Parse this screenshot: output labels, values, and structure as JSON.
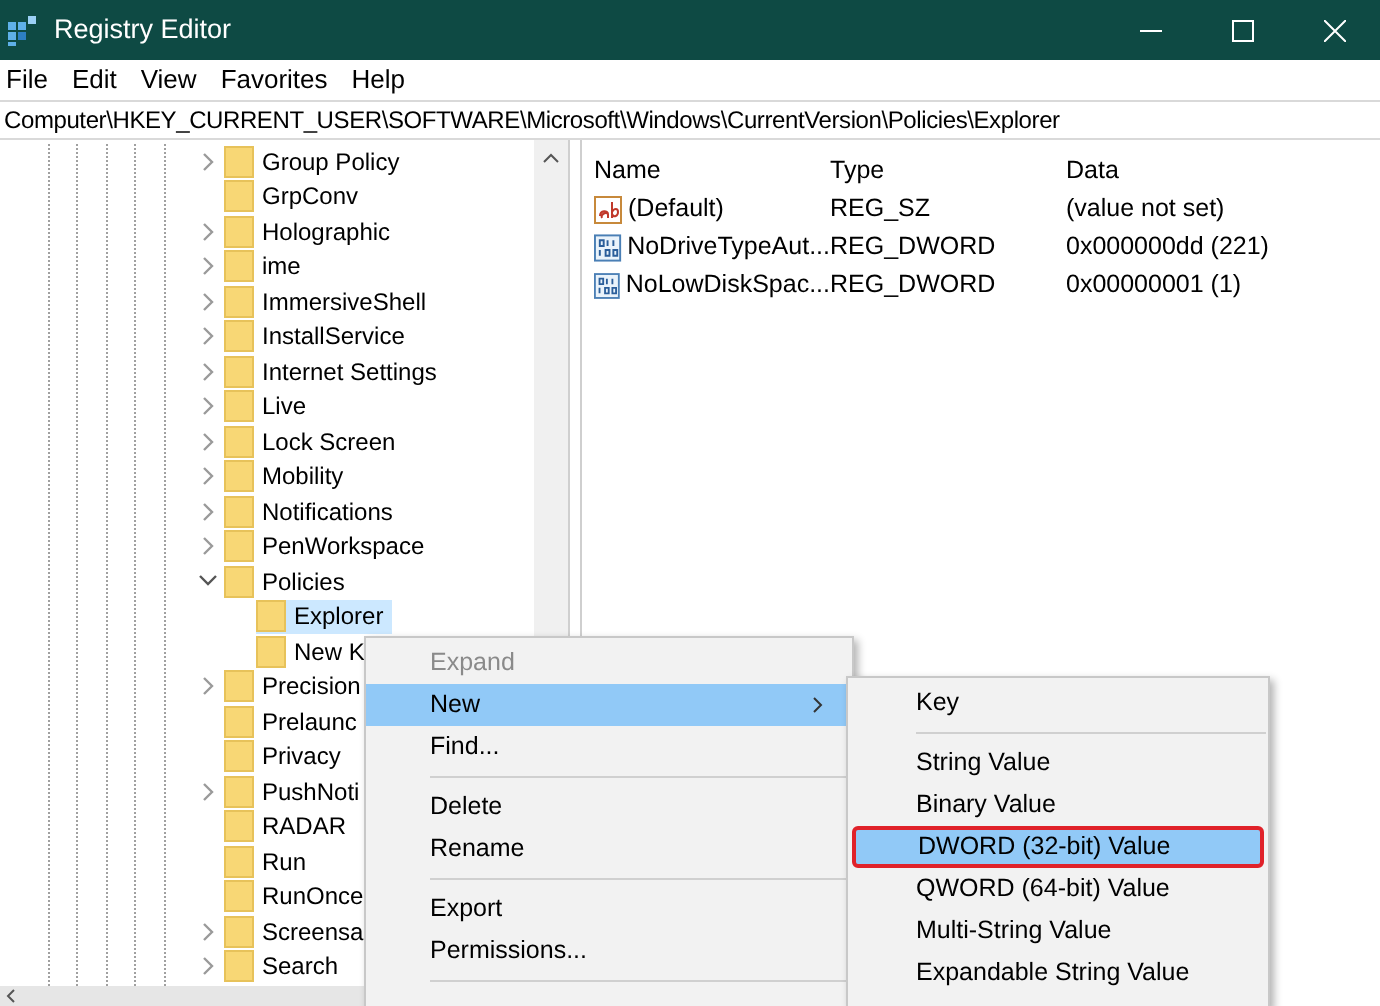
{
  "window": {
    "title": "Registry Editor"
  },
  "menu_bar": [
    {
      "label": "File"
    },
    {
      "label": "Edit"
    },
    {
      "label": "View"
    },
    {
      "label": "Favorites"
    },
    {
      "label": "Help"
    }
  ],
  "address_bar": {
    "value": "Computer\\HKEY_CURRENT_USER\\SOFTWARE\\Microsoft\\Windows\\CurrentVersion\\Policies\\Explorer"
  },
  "tree": [
    {
      "label": "Group Policy",
      "expanded": false,
      "selected": false
    },
    {
      "label": "GrpConv",
      "selected": false
    },
    {
      "label": "Holographic",
      "expanded": false,
      "selected": false
    },
    {
      "label": "ime",
      "expanded": false,
      "selected": false
    },
    {
      "label": "ImmersiveShell",
      "expanded": false,
      "selected": false
    },
    {
      "label": "InstallService",
      "expanded": false,
      "selected": false
    },
    {
      "label": "Internet Settings",
      "expanded": false,
      "selected": false
    },
    {
      "label": "Live",
      "expanded": false,
      "selected": false
    },
    {
      "label": "Lock Screen",
      "expanded": false,
      "selected": false
    },
    {
      "label": "Mobility",
      "expanded": false,
      "selected": false
    },
    {
      "label": "Notifications",
      "expanded": false,
      "selected": false
    },
    {
      "label": "PenWorkspace",
      "expanded": false,
      "selected": false
    },
    {
      "label": "Policies",
      "expanded": true,
      "selected": false,
      "children": [
        {
          "label": "Explorer",
          "selected": true
        },
        {
          "label": "New K",
          "selected": false
        }
      ]
    },
    {
      "label": "Precision",
      "expanded": false,
      "selected": false
    },
    {
      "label": "Prelaunc",
      "selected": false
    },
    {
      "label": "Privacy",
      "selected": false
    },
    {
      "label": "PushNoti",
      "expanded": false,
      "selected": false
    },
    {
      "label": "RADAR",
      "selected": false
    },
    {
      "label": "Run",
      "selected": false
    },
    {
      "label": "RunOnce",
      "selected": false
    },
    {
      "label": "Screensa",
      "expanded": false,
      "selected": false
    },
    {
      "label": "Search",
      "expanded": false,
      "selected": false
    }
  ],
  "values_table": {
    "columns": [
      "Name",
      "Type",
      "Data"
    ],
    "rows": [
      {
        "kind": "string",
        "name": "(Default)",
        "type": "REG_SZ",
        "data": "(value not set)"
      },
      {
        "kind": "binary",
        "name": "NoDriveTypeAut...",
        "type": "REG_DWORD",
        "data": "0x000000dd (221)"
      },
      {
        "kind": "binary",
        "name": "NoLowDiskSpac...",
        "type": "REG_DWORD",
        "data": "0x00000001 (1)"
      }
    ]
  },
  "context_menu": [
    {
      "kind": "item",
      "label": "Expand",
      "disabled": true,
      "selected": false
    },
    {
      "kind": "submenu",
      "label": "New",
      "disabled": false,
      "selected": true
    },
    {
      "kind": "item",
      "label": "Find...",
      "disabled": false,
      "selected": false
    },
    {
      "kind": "separator"
    },
    {
      "kind": "item",
      "label": "Delete",
      "disabled": false,
      "selected": false
    },
    {
      "kind": "item",
      "label": "Rename",
      "disabled": false,
      "selected": false
    },
    {
      "kind": "separator"
    },
    {
      "kind": "item",
      "label": "Export",
      "disabled": false,
      "selected": false
    },
    {
      "kind": "item",
      "label": "Permissions...",
      "disabled": false,
      "selected": false
    },
    {
      "kind": "separator"
    }
  ],
  "submenu": [
    {
      "kind": "item",
      "label": "Key",
      "selected": false,
      "outlined": false
    },
    {
      "kind": "separator"
    },
    {
      "kind": "item",
      "label": "String Value",
      "selected": false,
      "outlined": false
    },
    {
      "kind": "item",
      "label": "Binary Value",
      "selected": false,
      "outlined": false
    },
    {
      "kind": "item",
      "label": "DWORD (32-bit) Value",
      "selected": true,
      "outlined": true
    },
    {
      "kind": "item",
      "label": "QWORD (64-bit) Value",
      "selected": false,
      "outlined": false
    },
    {
      "kind": "item",
      "label": "Multi-String Value",
      "selected": false,
      "outlined": false
    },
    {
      "kind": "item",
      "label": "Expandable String Value",
      "selected": false,
      "outlined": false
    }
  ]
}
